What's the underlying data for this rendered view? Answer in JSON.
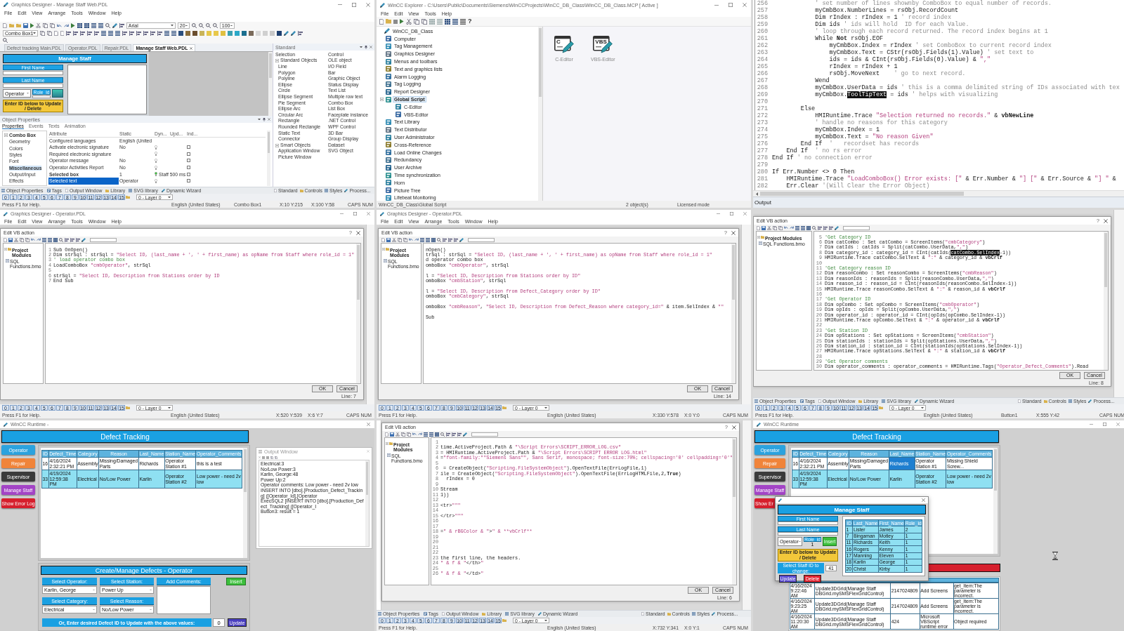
{
  "designer_manage_staff": {
    "title": "Graphics Designer - Manage Staff Web.PDL",
    "menus": [
      "File",
      "Edit",
      "View",
      "Arrange",
      "Tools",
      "Window",
      "Help"
    ],
    "font_name": "Arial",
    "font_size": "20",
    "zoom": "100",
    "object_select": "Combo Box1",
    "doc_tabs": [
      {
        "label": "Defect tracking Main.PDL",
        "selected": false
      },
      {
        "label": "Operator.PDL",
        "selected": false
      },
      {
        "label": "Repair.PDL",
        "selected": false
      },
      {
        "label": "Manage Staff Web.PDL",
        "selected": true
      }
    ],
    "picture": {
      "header": "Manage Staff",
      "first_name": "First Name",
      "last_name": "Last Name",
      "role_combo": "Operator",
      "role_label": "Role_id",
      "update_hint": "Enter ID below to Update / Delete"
    },
    "palette": {
      "title": "Standard",
      "items": [
        {
          "label": "Selection"
        },
        {
          "label": "Standard Objects",
          "expanded": true,
          "children": [
            {
              "label": "Line"
            },
            {
              "label": "Polygon"
            },
            {
              "label": "Polyline"
            },
            {
              "label": "Ellipse"
            },
            {
              "label": "Circle"
            },
            {
              "label": "Ellipse Segment"
            },
            {
              "label": "Pie Segment"
            },
            {
              "label": "Ellipse Arc"
            },
            {
              "label": "Circular Arc"
            },
            {
              "label": "Rectangle"
            },
            {
              "label": "Rounded Rectangle"
            },
            {
              "label": "Static Text"
            },
            {
              "label": "Connector"
            }
          ]
        },
        {
          "label": "Smart Objects",
          "expanded": true,
          "children": [
            {
              "label": "Application Window"
            },
            {
              "label": "Picture Window"
            },
            {
              "label": "Control"
            },
            {
              "label": "OLE object"
            },
            {
              "label": "I/O Field"
            },
            {
              "label": "Bar"
            },
            {
              "label": "Graphic Object"
            },
            {
              "label": "Status Display"
            },
            {
              "label": "Text List"
            },
            {
              "label": "Multiple row text"
            },
            {
              "label": "Combo Box"
            },
            {
              "label": "List Box"
            },
            {
              "label": "Faceplate instance"
            },
            {
              "label": ".NET Control"
            },
            {
              "label": "WPF Control"
            },
            {
              "label": "3D Bar"
            },
            {
              "label": "Group Display"
            },
            {
              "label": "Dataset"
            },
            {
              "label": "SVG Object"
            }
          ]
        }
      ]
    },
    "properties": {
      "title": "Object Properties",
      "tabs": [
        {
          "label": "Properties",
          "selected": true
        },
        {
          "label": "Events",
          "selected": false
        },
        {
          "label": "Texts",
          "selected": false
        },
        {
          "label": "Animation",
          "selected": false
        }
      ],
      "categories": [
        {
          "label": "Combo Box",
          "selected": false,
          "expanded": true,
          "children": [
            {
              "label": "Geometry",
              "selected": false
            },
            {
              "label": "Colors",
              "selected": false
            },
            {
              "label": "Styles",
              "selected": false
            },
            {
              "label": "Font",
              "selected": false
            },
            {
              "label": "Miscellaneous",
              "selected": true
            },
            {
              "label": "Output/Input",
              "selected": false
            },
            {
              "label": "Effects",
              "selected": false
            }
          ]
        }
      ],
      "columns": [
        "Attribute",
        "Static",
        "Dyn...",
        "Upd...",
        "Ind..."
      ],
      "rows": [
        {
          "attribute": "Configured languages",
          "static": "English (United",
          "selected": false
        },
        {
          "attribute": "Activate electronic signature",
          "static": "No",
          "dynamic": false,
          "indirect": false,
          "selected": false
        },
        {
          "attribute": "Required electronic signature",
          "dynamic": false,
          "indirect": false,
          "selected": false
        },
        {
          "attribute": "Operator message",
          "static": "No",
          "dynamic": false,
          "indirect": false,
          "selected": false
        },
        {
          "attribute": "Operator Activities Report",
          "static": "No",
          "dynamic": false,
          "indirect": false,
          "selected": false
        },
        {
          "attribute": "Selected box",
          "static": "1",
          "dynamic": true,
          "tag": "Staff 500 ms",
          "indirect": false,
          "selected": false
        },
        {
          "attribute": "Selected text",
          "static": "Operator",
          "dynamic": false,
          "indirect": false,
          "selected": true
        }
      ]
    },
    "bottom_tabs": [
      "Object Properties",
      "Tags",
      "Output Window",
      "Library",
      "SVG library",
      "Dynamic Wizard"
    ],
    "palette_tabs": [
      "Standard",
      "Controls",
      "Styles",
      "Process..."
    ],
    "layers": [
      "0",
      "1",
      "2",
      "3",
      "4",
      "5",
      "6",
      "7",
      "8",
      "9",
      "10",
      "11",
      "12",
      "13",
      "14",
      "15"
    ],
    "layer_select": "0 - Layer 0",
    "status": [
      "Press F1 for Help.",
      "English (United States)",
      "Combo Box1",
      "X:10 Y:215",
      "X:100 Y:58",
      "CAPS NUM"
    ]
  },
  "wincc_explorer": {
    "title": "WinCC Explorer - C:\\Users\\Public\\Documents\\Siemens\\WinCCProjects\\WinCC_DB_Class\\WinCC_DB_Class.MCP [ Active ]",
    "menus": [
      "File",
      "Edit",
      "View",
      "Tools",
      "Help"
    ],
    "help": "?",
    "tree": [
      {
        "label": "WinCC_DB_Class",
        "selected": false,
        "children": [
          {
            "label": "Computer",
            "selected": false
          },
          {
            "label": "Tag Management",
            "selected": false
          },
          {
            "label": "Graphics Designer",
            "selected": false
          },
          {
            "label": "Menus and toolbars",
            "selected": false
          },
          {
            "label": "Text and graphics lists",
            "selected": false
          },
          {
            "label": "Alarm Logging",
            "selected": false
          },
          {
            "label": "Tag Logging",
            "selected": false
          },
          {
            "label": "Report Designer",
            "selected": false
          },
          {
            "label": "Global Script",
            "selected": true,
            "expanded": true,
            "children": [
              {
                "label": "C-Editor",
                "selected": false
              },
              {
                "label": "VBS-Editor",
                "selected": false
              }
            ]
          },
          {
            "label": "Text Library",
            "selected": false
          },
          {
            "label": "Text Distributor",
            "selected": false
          },
          {
            "label": "User Administrator",
            "selected": false
          },
          {
            "label": "Cross-Reference",
            "selected": false
          },
          {
            "label": "Load Online Changes",
            "selected": false
          },
          {
            "label": "Redundancy",
            "selected": false
          },
          {
            "label": "User Archive",
            "selected": false
          },
          {
            "label": "Time synchronization",
            "selected": false
          },
          {
            "label": "Horn",
            "selected": false
          },
          {
            "label": "Picture Tree",
            "selected": false
          },
          {
            "label": "Lifebeat Monitoring",
            "selected": false
          }
        ]
      }
    ],
    "editors": [
      {
        "badge": "C",
        "label": "C-Editor"
      },
      {
        "badge": "VBS",
        "label": "VBS-Editor"
      }
    ],
    "status": [
      "WinCC_DB_Class\\Global Script",
      "2 object(s)",
      "Licensed mode"
    ]
  },
  "script_editor": {
    "lines": [
      {
        "n": "256",
        "text": "            ' set number of lines shownby ComboBox to equal number of records."
      },
      {
        "n": "257",
        "text": "            myCmbBox.NumberLines = rsObj.RecordCount"
      },
      {
        "n": "258",
        "text": "            Dim rIndex : rIndex = 1 ' record index"
      },
      {
        "n": "259",
        "text": "            Dim ids ' ids will hold  ID for each Value."
      },
      {
        "n": "260",
        "text": "            ' loop through each record returned. The record index begins at 1"
      },
      {
        "n": "261",
        "text": "            While **Not** rsObj.EOF"
      },
      {
        "n": "262",
        "text": "                myCmbBox.Index = rIndex ' set ComboBox to current record index"
      },
      {
        "n": "263",
        "text": "                myCmbBox.Text = CStr(rsObj.Fields(1).Value) ' set text to"
      },
      {
        "n": "264",
        "text": "                ids = ids & CInt(rsObj.Fields(0).Value) & \",\""
      },
      {
        "n": "265",
        "text": "                rIndex = rIndex + 1"
      },
      {
        "n": "266",
        "text": "                rsObj.MoveNext    ' go to next record."
      },
      {
        "n": "267",
        "text": "            Wend"
      },
      {
        "n": "268",
        "text": "            myCmbBox.UserData = ids ' this is a comma delimited string of IDs associated with tex"
      },
      {
        "n": "269",
        "parts": [
          {
            "text": "            myCmbBox.",
            "selected": false
          },
          {
            "text": "ToolTipText",
            "selected": true
          },
          {
            "text": " = ids ' helps with visualizing",
            "selected": false
          }
        ]
      },
      {
        "n": "270"
      },
      {
        "n": "271",
        "text": "        Else"
      },
      {
        "n": "272",
        "text": "            HMIRuntime.Trace \"Selection returned no records.\" & **vbNewLine**"
      },
      {
        "n": "273",
        "text": "            ' handle no reasons for this category"
      },
      {
        "n": "274",
        "text": "            myCmbBox.Index = 1"
      },
      {
        "n": "275",
        "text": "            myCmbBox.Text = \"No reason Given\""
      },
      {
        "n": "276",
        "text": "        End If  '   recordset has records"
      },
      {
        "n": "277",
        "text": "    End If  ' no rs error"
      },
      {
        "n": "278",
        "text": "End If ' no connection error"
      },
      {
        "n": "279"
      },
      {
        "n": "280",
        "text": "If Err.Number <> 0 Then"
      },
      {
        "n": "281",
        "text": "    HMIRuntime.Trace \"LoadComboBox() Error exists: [\" & Err.Number & \"] [\" & Err.Source & \"] \" &"
      },
      {
        "n": "282",
        "text": "    Err.Clear '(Will Clear the Error Object)"
      }
    ],
    "output_label": "Output"
  },
  "vb_action_operator_1": {
    "app_title": "Graphics Designer - Operator.PDL",
    "menus": [
      "File",
      "Edit",
      "View",
      "Arrange",
      "Tools",
      "Window",
      "Help"
    ],
    "dialog": {
      "title": "Edit VB action",
      "help": "?",
      "tree": [
        {
          "label": "Project Modules",
          "expanded": true,
          "children": [
            {
              "label": "SQL Functions.bmo"
            }
          ]
        }
      ],
      "lines": [
        {
          "n": "1",
          "text": "Sub OnOpen()"
        },
        {
          "n": "2",
          "text": "Dim strSql : strSql = \"Select ID, (last_name + ', ' + first_name) as opName from Staff where role_id = 1\""
        },
        {
          "n": "3",
          "text": "' load operator combo box"
        },
        {
          "n": "4",
          "text": "LoadComboBox \"cmbOperator\", strSql"
        },
        {
          "n": "5"
        },
        {
          "n": "6",
          "text": "strSql = \"Select ID, Description from Stations order by ID"
        },
        {
          "n": "7",
          "text": "End Sub"
        }
      ],
      "ok": "OK",
      "cancel": "Cancel",
      "position": "Line: 7"
    },
    "layers": [
      "0",
      "1",
      "2",
      "3",
      "4",
      "5",
      "6",
      "7",
      "8",
      "9",
      "10",
      "11",
      "12",
      "13",
      "14",
      "15"
    ],
    "layer_select": "0 - Layer 0",
    "status": [
      "Press F1 for Help.",
      "English (United States)",
      "X:520 Y:539",
      "X:6 Y:7",
      "CAPS NUM"
    ]
  },
  "vb_action_operator_2": {
    "app_title": "Graphics Designer - Operator.PDL",
    "menus": [
      "File",
      "Edit",
      "View",
      "Arrange",
      "Tools",
      "Window",
      "Help"
    ],
    "dialog": {
      "title": "Edit VB action",
      "help": "?",
      "tree": [
        {
          "label": "Project Modules",
          "expanded": true,
          "children": [
            {
              "label": "SQL Functions.bmo"
            }
          ]
        }
      ],
      "line_groups": [
        [
          {
            "text": "nOpen()"
          },
          {
            "text": "trSql : strSql = \"Select ID, (last_name + ', ' + first_name) as opName from Staff where role_id = 1\""
          },
          {
            "text": "d operator combo box"
          },
          {
            "text": "omboBox \"cmbOperator\", strSql"
          }
        ],
        [
          {
            "text": "l = \"Select ID, Description from Stations order by ID\""
          },
          {
            "text": "omboBox \"cmbStation\", strSql"
          }
        ],
        [
          {
            "text": "l = \"Select ID, Description from Defect_Category order by ID\""
          },
          {
            "text": "omboBox \"cmbCategory\", strSql"
          }
        ],
        [
          {
            "text": "omboBox \"cmbReason\", \"Select ID, Description from Defect_Reason where category_id=\" & item.SelIndex & \"\""
          }
        ],
        [
          {
            "text": "Sub"
          }
        ]
      ],
      "ok": "OK",
      "cancel": "Cancel",
      "position": "Line: 14"
    },
    "layers": [
      "0",
      "1",
      "2",
      "3",
      "4",
      "5",
      "6",
      "7",
      "8",
      "9",
      "10",
      "11",
      "12",
      "13",
      "14",
      "15"
    ],
    "layer_select": "0 - Layer 0",
    "status": [
      "Press F1 for Help.",
      "English (United States)",
      "X:330 Y:578",
      "X:0 Y:0",
      "CAPS NUM"
    ]
  },
  "vb_action_commit": {
    "dialog": {
      "title": "Edit VB action",
      "help": "?",
      "tree": [
        {
          "label": "Project Modules",
          "expanded": true,
          "children": [
            {
              "label": "SQL Functions.bmo"
            }
          ]
        }
      ],
      "lines": [
        {
          "n": "5",
          "text": "'Get Category ID"
        },
        {
          "n": "6",
          "text": "Dim catCombo : Set catCombo = ScreenItems(\"cmbCategory\")"
        },
        {
          "n": "7",
          "text": "Dim catIds : catIds = Split(catCombo.UserData,\",\")"
        },
        {
          "n": "8",
          "parts": [
            {
              "text": "Dim category_id : category_id = CInt(catIds(",
              "selected": false
            },
            {
              "text": "catCombo.SelIndex",
              "selected": true
            },
            {
              "text": "-1))",
              "selected": false
            }
          ]
        },
        {
          "n": "9",
          "text": "HMIRuntime.Trace catCombo.SelText & \":\" & category_id & **vbCrlf**"
        },
        {
          "n": "10"
        },
        {
          "n": "11",
          "text": "'Get Category reason ID"
        },
        {
          "n": "12",
          "text": "Dim reasonCombo : Set reasonCombo = ScreenItems(\"cmbReason\")"
        },
        {
          "n": "13",
          "text": "Dim reasonIds : reasonIds = Split(reasonCombo.UserData,\",\")"
        },
        {
          "n": "14",
          "text": "Dim reason_id : reason_id = CInt(reasonIds(reasonCombo.SelIndex-1))"
        },
        {
          "n": "15",
          "text": "HMIRuntime.Trace reasonCombo.SelText & \":\" & reason_id & **vbCrlf**"
        },
        {
          "n": "16"
        },
        {
          "n": "17",
          "text": "'Get Operator ID"
        },
        {
          "n": "18",
          "text": "Dim opCombo : Set opCombo = ScreenItems(\"cmbOperator\")"
        },
        {
          "n": "19",
          "text": "Dim opIds : opIds = Split(opCombo.UserData,\",\")"
        },
        {
          "n": "20",
          "text": "Dim operator_id : operator_id = CInt(opIds(opCombo.SelIndex-1))"
        },
        {
          "n": "21",
          "text": "HMIRuntime.Trace opCombo.SelText & \":\" & operator_id & **vbCrlf**"
        },
        {
          "n": "22"
        },
        {
          "n": "23",
          "text": "'Get Station ID"
        },
        {
          "n": "24",
          "text": "Dim opStations : Set opStations = ScreenItems(\"cmbStation\")"
        },
        {
          "n": "25",
          "text": "Dim stationIds : stationIds = Split(opStations.UserData,\",\")"
        },
        {
          "n": "26",
          "text": "Dim station_id : station_id = CInt(stationIds(opStations.SelIndex-1))"
        },
        {
          "n": "27",
          "text": "HMIRuntime.Trace opStations.SelText & \":\" & station_id & **vbCrlf**"
        },
        {
          "n": "28"
        },
        {
          "n": "29",
          "text": "'Get Operator comments"
        },
        {
          "n": "30",
          "text": "Dim operator_comments : operator_comments = HMIRuntime.Tags(\"Operator_Defect_Comments\").Read"
        }
      ],
      "ok": "OK",
      "cancel": "Cancel",
      "position": "Line: 8"
    },
    "bottom_tabs": [
      "Object Properties",
      "Tags",
      "Output Window",
      "Library",
      "SVG library",
      "Dynamic Wizard"
    ],
    "palette_tabs": [
      "Standard",
      "Controls",
      "Styles",
      "Process..."
    ],
    "layers": [
      "0",
      "1",
      "2",
      "3",
      "4",
      "5",
      "6",
      "7",
      "8",
      "9",
      "10",
      "11",
      "12",
      "13",
      "14",
      "15"
    ],
    "layer_select": "0 - Layer 0",
    "status": [
      "Press F1 for Help.",
      "English (United States)",
      "Button1",
      "X:555 Y:42",
      "CAPS NUM"
    ]
  },
  "runtime_operator": {
    "title": "WinCC Runtime -",
    "header": "Defect Tracking",
    "nav": [
      {
        "label": "Operator",
        "color": "#2ba2de"
      },
      {
        "label": "Repair",
        "color": "#f0843a"
      },
      {
        "label": "Supervisor",
        "color": "#3b3b3b"
      },
      {
        "label": "Manage Staff",
        "color": "#a344c6"
      },
      {
        "label": "Show Error Log",
        "color": "#d61f2d"
      }
    ],
    "table": {
      "columns": [
        "ID",
        "Defect_Time",
        "Category",
        "Reason",
        "Last_Name",
        "Station_Name",
        "Operator_Comments"
      ],
      "rows": [
        {
          "cells": [
            "16",
            "4/16/2024 2:32:21 PM",
            "Assembly",
            "Missing/Damaged Parts",
            "Richards",
            "Operator Station #1",
            "this is a test"
          ],
          "selected": false
        },
        {
          "cells": [
            "33",
            "4/19/2024 12:59:38 PM",
            "Electrical",
            "No/Low Power",
            "Karlin",
            "Operator Station #2",
            "Low power - need 2v low"
          ],
          "selected": true
        }
      ]
    },
    "output": {
      "title": "Output Window",
      "lines": [
        "Electrical:3",
        "No/Low Power:3",
        "Karlin, George:48",
        "Power Up:2",
        "Operator comments: Low power - need 2v low",
        "INSERT INTO [dbo].[Production_Defect_Tracking] ([Operator_Id],[Operator",
        "ExecSQL2 [INSERT INTO [dbo].[Production_Defect_Tracking] ([Operator_I",
        "Button3: result = 1"
      ]
    },
    "form": {
      "title": "Create/Manage Defects - Operator",
      "fields": [
        {
          "label": "Select Operator:",
          "value": "Karlin, George"
        },
        {
          "label": "Select Station:",
          "value": "Power Up"
        },
        {
          "label": "Select Category:",
          "value": "Electrical"
        },
        {
          "label": "Select Reason:",
          "value": "No/Low Power"
        }
      ],
      "comments_label": "Add Comments:",
      "insert": "Insert",
      "update_prompt": "Or, Enter desired Defect ID to Update with the above values:",
      "update_id": "0",
      "update": "Update"
    }
  },
  "vb_action_error_log": {
    "dialog": {
      "title": "Edit VB action",
      "help": "?",
      "tree": [
        {
          "label": "Project Modules",
          "expanded": true,
          "children": [
            {
              "label": "SQL Functions.bmo"
            }
          ]
        }
      ],
      "lines": [
        {
          "n": "1"
        },
        {
          "n": "2",
          "text": "time.ActiveProject.Path & \"\\Script Errors\\SCRIPT_ERROR_LOG.csv\""
        },
        {
          "n": "3",
          "text": "= HMIRuntime.ActiveProject.Path & \"\\Script Errors\\SCRIPT ERROR LOG.html\""
        },
        {
          "n": "4",
          "text": "=\"font-family:\"\"Siemens Sans\"\", Sans Serif, monospace; font-size:70%; cellspacing='0' cellpadding='0'\""
        },
        {
          "n": "5"
        },
        {
          "n": "6",
          "text": " = CreateObject(\"Scripting.FileSystemObject\").OpenTextFile(ErrLogFile,1)"
        },
        {
          "n": "7",
          "text": "ile = CreateObject(\"Scripting.FileSystemObject\").OpenTextFile(ErrLogHTMLFile,2,**True**)"
        },
        {
          "n": "8",
          "text": "  rIndex = 0"
        },
        {
          "n": "9"
        },
        {
          "n": "10",
          "text": "Stream"
        },
        {
          "n": "11",
          "text": "1))"
        },
        {
          "n": "12"
        },
        {
          "n": "13",
          "text": "<tr>\"\"\""
        },
        {
          "n": "14"
        },
        {
          "n": "15",
          "text": "</tr>\"\"\""
        },
        {
          "n": "16"
        },
        {
          "n": "17"
        },
        {
          "n": "18",
          "text": "=\" & rBGColor & \">\" & **vbCrlf**"
        },
        {
          "n": "19"
        },
        {
          "n": "20"
        },
        {
          "n": "21"
        },
        {
          "n": "22"
        },
        {
          "n": "23",
          "text": "the first line, the headers."
        },
        {
          "n": "24",
          "text": "\" & f & \"</th>\""
        },
        {
          "n": "25"
        },
        {
          "n": "26",
          "text": "\" & f & \"</td>\""
        }
      ],
      "ok": "OK",
      "cancel": "Cancel",
      "position": "Line: 6"
    },
    "bottom_tabs": [
      "Object Properties",
      "Tags",
      "Output Window",
      "Library",
      "SVG library",
      "Dynamic Wizard"
    ],
    "palette_tabs": [
      "Standard",
      "Controls",
      "Styles",
      "Process..."
    ],
    "layers": [
      "0",
      "1",
      "2",
      "3",
      "4",
      "5",
      "6",
      "7",
      "8",
      "9",
      "10",
      "11",
      "12",
      "13",
      "14",
      "15"
    ],
    "layer_select": "0 - Layer 0",
    "status": [
      "Press F1 for Help.",
      "English (United States)",
      "X:732 Y:341",
      "X:0 Y:1",
      "CAPS NUM"
    ]
  },
  "runtime_manage_staff": {
    "title": "WinCC Runtime",
    "header": "Defect Tracking",
    "nav": [
      {
        "label": "Operator",
        "color": "#2ba2de"
      },
      {
        "label": "Repair",
        "color": "#f0843a"
      },
      {
        "label": "Supervisor",
        "color": "#3b3b3b"
      },
      {
        "label": "Manage Staff",
        "color": "#a344c6"
      },
      {
        "label": "Show Er",
        "color": "#d61f2d"
      }
    ],
    "table": {
      "columns": [
        "ID",
        "Defect_Time",
        "Category",
        "Reason",
        "Last_Name",
        "Station_Name",
        "Operator_Comments"
      ],
      "rows": [
        {
          "cells": [
            {
              "text": "16",
              "selected": false
            },
            {
              "text": "4/16/2024 2:32:21 PM",
              "selected": false
            },
            {
              "text": "Assembly",
              "selected": false
            },
            {
              "text": "Missing/Damaged Parts",
              "selected": false
            },
            {
              "text": "Richards",
              "selected": true
            },
            {
              "text": "Operator Station #1",
              "selected": false
            },
            {
              "text": "Missing Shield Screw...",
              "selected": false
            }
          ],
          "selected": false
        },
        {
          "cells": [
            {
              "text": "33",
              "selected": false
            },
            {
              "text": "4/19/2024 12:59:38 PM",
              "selected": false
            },
            {
              "text": "Electrical",
              "selected": false
            },
            {
              "text": "No/Low Power",
              "selected": false
            },
            {
              "text": "Karlin",
              "selected": false
            },
            {
              "text": "Operator Station #2",
              "selected": false
            },
            {
              "text": "Low power - need 2v low",
              "selected": false
            }
          ],
          "selected": true
        }
      ]
    },
    "error_log": [
      [
        "4/16/2024 9:22:46 AM",
        "Update3DGrid(Manage Staff DBGrid.mySMSFlexGridControl)",
        "2147024809",
        "Add Screens",
        "get_Item:The parameter is incorrect."
      ],
      [
        "4/16/2024 9:23:25 AM",
        "Update3DGrid(Manage Staff DBGrid.mySMSFlexGridControl)",
        "2147024809",
        "Add Screens",
        "get_Item:The parameter is incorrect."
      ],
      [
        "4/16/2024 11:20:30 AM",
        "Update3DGrid(Manage Staff DBGrid.mySMSFlexGridControl)",
        "424",
        "Microsoft VBScript runtime error",
        "Object required"
      ]
    ],
    "popup": {
      "header": "Manage Staff",
      "first_name": "First Name",
      "last_name": "Last Name",
      "role_combo": "Operator",
      "role_label": "Role_id",
      "role_value": "1",
      "insert": "Insert",
      "update_hint": "Enter ID below to Update / Delete",
      "select_label": "Select Staff ID to change:",
      "select_value": "41",
      "update": "Update",
      "delete": "Delete",
      "staff_columns": [
        "ID",
        "Last_Name",
        "First_Name",
        "Role_id"
      ],
      "staff_rows": [
        {
          "cells": [
            "1",
            "Lister",
            "James",
            "2"
          ],
          "selected": false
        },
        {
          "cells": [
            "7",
            "Bingaman",
            "Motley",
            "1"
          ],
          "selected": false
        },
        {
          "cells": [
            "11",
            "Richards",
            "Keith",
            "1"
          ],
          "selected": false
        },
        {
          "cells": [
            "16",
            "Rogers",
            "Kenny",
            "1"
          ],
          "selected": false
        },
        {
          "cells": [
            "17",
            "Manning",
            "Eleven",
            "1"
          ],
          "selected": false
        },
        {
          "cells": [
            "18",
            "Karlin",
            "George",
            "1"
          ],
          "selected": false
        },
        {
          "cells": [
            "20",
            "Christ",
            "Kirby",
            "1"
          ],
          "selected": false
        }
      ]
    }
  }
}
